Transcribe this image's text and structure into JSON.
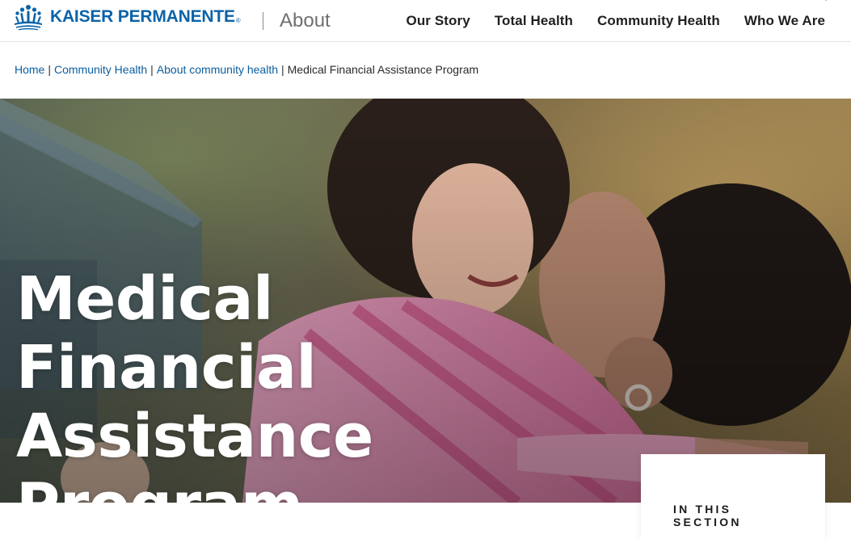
{
  "header": {
    "brand_name": "KAISER PERMANENTE",
    "brand_reg": "®",
    "section_label": "About",
    "nav": [
      {
        "label": "Our Story"
      },
      {
        "label": "Total Health"
      },
      {
        "label": "Community Health"
      },
      {
        "label": "Who We Are"
      }
    ]
  },
  "breadcrumb": {
    "items": [
      {
        "label": "Home"
      },
      {
        "label": "Community Health"
      },
      {
        "label": "About community health"
      }
    ],
    "separator": "|",
    "current": "Medical Financial Assistance Program"
  },
  "hero": {
    "title_lines": [
      "Medical Financial",
      "Assistance",
      "Program"
    ]
  },
  "section_card": {
    "label_lines": [
      "IN THIS",
      "SECTION"
    ]
  },
  "colors": {
    "brand_blue": "#0b63a8",
    "link_blue": "#0b5ea0",
    "hero_text": "#ffffff"
  }
}
